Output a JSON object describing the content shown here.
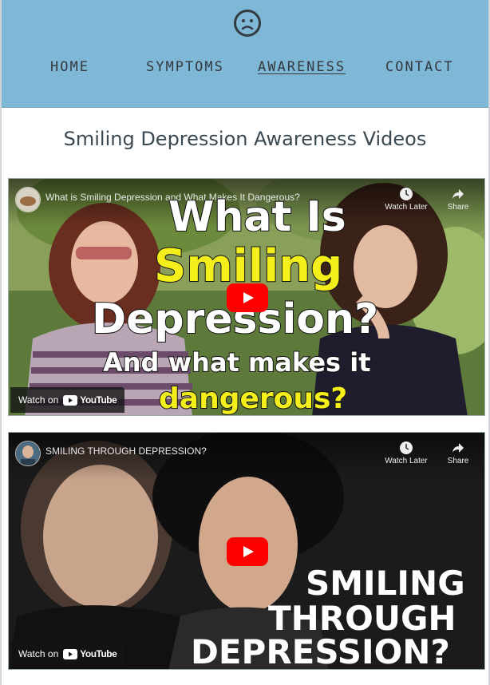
{
  "nav": {
    "items": [
      {
        "label": "HOME",
        "active": false
      },
      {
        "label": "SYMPTOMS",
        "active": false
      },
      {
        "label": "AWARENESS",
        "active": true
      },
      {
        "label": "CONTACT",
        "active": false
      }
    ]
  },
  "page": {
    "title": "Smiling Depression Awareness Videos"
  },
  "videos": [
    {
      "title": "What is Smiling Depression and What Makes It Dangerous?",
      "watch_later_label": "Watch Later",
      "share_label": "Share",
      "watch_on_label": "Watch on",
      "youtube_label": "YouTube",
      "thumbnail_text": {
        "line1": "What Is",
        "line2": "Smiling",
        "line3": "Depression?",
        "line4": "And what makes it",
        "line5": "dangerous?"
      }
    },
    {
      "title": "SMILING THROUGH DEPRESSION?",
      "watch_later_label": "Watch Later",
      "share_label": "Share",
      "watch_on_label": "Watch on",
      "youtube_label": "YouTube",
      "thumbnail_text": {
        "line1": "SMILING",
        "line2": "THROUGH",
        "line3": "DEPRESSION?"
      }
    }
  ],
  "colors": {
    "header_bg": "#7fb7d6",
    "nav_text": "#333a40",
    "title_text": "#3a4852",
    "youtube_red": "#ff0000",
    "highlight_yellow": "#f4ee1a"
  },
  "icons": {
    "logo": "neutral-face-icon",
    "watch_later": "clock-icon",
    "share": "share-arrow-icon",
    "play": "youtube-play-icon"
  }
}
